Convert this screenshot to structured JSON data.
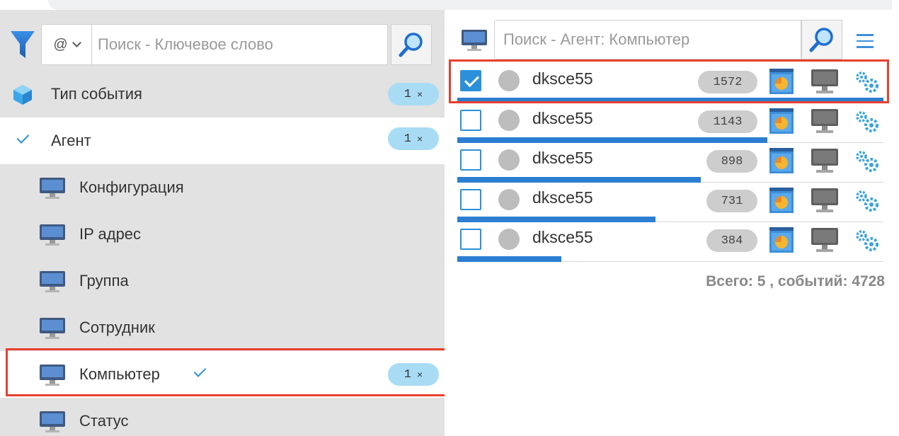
{
  "left": {
    "selector_value": "@",
    "search_placeholder": "Поиск - Ключевое слово",
    "filters": [
      {
        "label": "Тип события",
        "badge_count": "1",
        "badge_close": "×",
        "icon": "cube-icon",
        "state": "normal"
      },
      {
        "label": "Агент",
        "badge_count": "1",
        "badge_close": "×",
        "icon": "check-icon",
        "state": "active"
      },
      {
        "label": "Конфигурация",
        "icon": "monitor-icon",
        "state": "sub"
      },
      {
        "label": "IP адрес",
        "icon": "monitor-icon",
        "state": "sub"
      },
      {
        "label": "Группа",
        "icon": "monitor-icon",
        "state": "sub"
      },
      {
        "label": "Сотрудник",
        "icon": "monitor-icon",
        "state": "sub"
      },
      {
        "label": "Компьютер",
        "badge_count": "1",
        "badge_close": "×",
        "icon": "monitor-icon",
        "state": "sub-selected"
      },
      {
        "label": "Статус",
        "icon": "monitor-icon",
        "state": "sub"
      }
    ]
  },
  "right": {
    "search_placeholder": "Поиск - Агент: Компьютер",
    "agents": [
      {
        "name": "dksce55",
        "count": "1572",
        "checked": true,
        "bar_fraction": 1.0
      },
      {
        "name": "dksce55",
        "count": "1143",
        "checked": false,
        "bar_fraction": 0.727
      },
      {
        "name": "dksce55",
        "count": "898",
        "checked": false,
        "bar_fraction": 0.571
      },
      {
        "name": "dksce55",
        "count": "731",
        "checked": false,
        "bar_fraction": 0.465
      },
      {
        "name": "dksce55",
        "count": "384",
        "checked": false,
        "bar_fraction": 0.244
      }
    ],
    "total_text": "Всего: 5 , событий: 4728"
  },
  "colors": {
    "accent": "#2b90d9",
    "highlight": "#e8402e",
    "badge": "#a8dcf5",
    "panel": "#e2e2e2"
  }
}
